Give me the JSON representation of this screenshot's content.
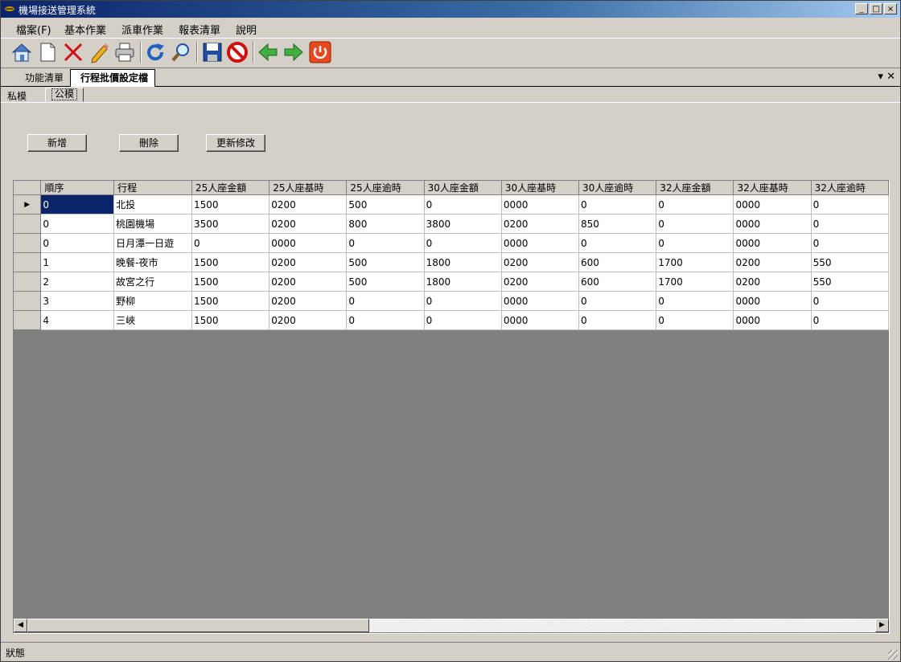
{
  "window": {
    "title": "機場接送管理系統"
  },
  "menu": [
    "檔案(F)",
    "基本作業",
    "派車作業",
    "報表清單",
    "說明"
  ],
  "toolbar": [
    "home-icon",
    "new-document-icon",
    "delete-icon",
    "edit-icon",
    "print-icon",
    "refresh-icon",
    "search-icon",
    "save-icon",
    "cancel-icon",
    "back-arrow-icon",
    "forward-arrow-icon",
    "power-icon"
  ],
  "tabs": {
    "function_list": "功能清單",
    "active": "行程批價設定檔"
  },
  "subtabs": {
    "private": "私模",
    "public": "公模"
  },
  "buttons": {
    "add": "新增",
    "delete": "刪除",
    "update": "更新修改"
  },
  "grid": {
    "columns": [
      "順序",
      "行程",
      "25人座金額",
      "25人座基時",
      "25人座逾時",
      "30人座金額",
      "30人座基時",
      "30人座逾時",
      "32人座金額",
      "32人座基時",
      "32人座逾時"
    ],
    "rows": [
      [
        "0",
        "北投",
        "1500",
        "0200",
        "500",
        "0",
        "0000",
        "0",
        "0",
        "0000",
        "0"
      ],
      [
        "0",
        "桃園機場",
        "3500",
        "0200",
        "800",
        "3800",
        "0200",
        "850",
        "0",
        "0000",
        "0"
      ],
      [
        "0",
        "日月潭一日遊",
        "0",
        "0000",
        "0",
        "0",
        "0000",
        "0",
        "0",
        "0000",
        "0"
      ],
      [
        "1",
        "晚餐-夜市",
        "1500",
        "0200",
        "500",
        "1800",
        "0200",
        "600",
        "1700",
        "0200",
        "550"
      ],
      [
        "2",
        "故宮之行",
        "1500",
        "0200",
        "500",
        "1800",
        "0200",
        "600",
        "1700",
        "0200",
        "550"
      ],
      [
        "3",
        "野柳",
        "1500",
        "0200",
        "0",
        "0",
        "0000",
        "0",
        "0",
        "0000",
        "0"
      ],
      [
        "4",
        "三峽",
        "1500",
        "0200",
        "0",
        "0",
        "0000",
        "0",
        "0",
        "0000",
        "0"
      ]
    ]
  },
  "status": {
    "label": "狀態"
  }
}
